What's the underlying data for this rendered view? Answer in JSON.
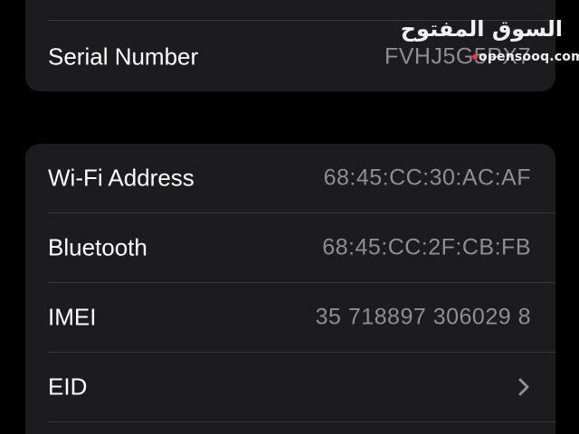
{
  "colors": {
    "background": "#000000",
    "group_background": "#1c1c1e",
    "label_text": "#ffffff",
    "value_text": "#8e8e93",
    "divider": "#38383a",
    "chevron": "#8e8e93"
  },
  "top_group": {
    "serial_number": {
      "label": "Serial Number",
      "value": "FVHJ5G5PX7"
    }
  },
  "main_group": {
    "rows": [
      {
        "label": "Wi-Fi Address",
        "value": "68:45:CC:30:AC:AF"
      },
      {
        "label": "Bluetooth",
        "value": "68:45:CC:2F:CB:FB"
      },
      {
        "label": "IMEI",
        "value": "35 718897 306029 8"
      },
      {
        "label": "EID",
        "value": "",
        "icon": "chevron-right-icon"
      }
    ]
  },
  "watermark": {
    "arabic": "السوق المفتوح",
    "latin": "opensooq.com"
  }
}
